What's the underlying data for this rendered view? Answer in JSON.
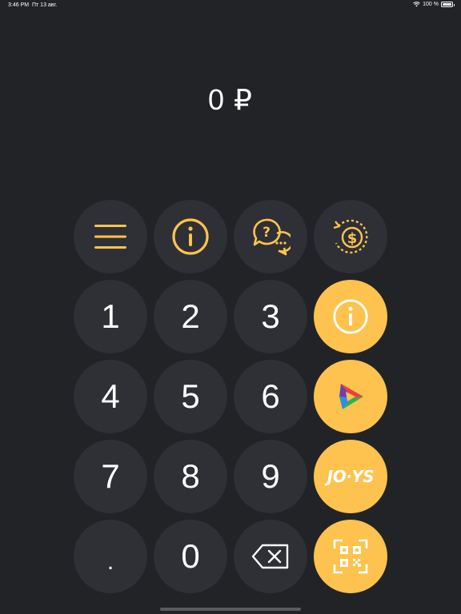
{
  "status_bar": {
    "time": "3:46 PM",
    "date": "Пт 13 авг.",
    "battery": "100 %"
  },
  "display": {
    "amount": "0 ₽"
  },
  "keypad": {
    "keys": {
      "one": "1",
      "two": "2",
      "three": "3",
      "four": "4",
      "five": "5",
      "six": "6",
      "seven": "7",
      "eight": "8",
      "nine": "9",
      "dot": ".",
      "zero": "0"
    },
    "joys_label": "JO·YS"
  },
  "icons": {
    "menu": "menu-icon",
    "info": "info-icon",
    "support": "chat-question-icon",
    "refund": "money-refund-icon",
    "info_action": "info-icon",
    "play": "play-logo-icon",
    "qr": "qr-code-icon",
    "backspace": "backspace-icon"
  },
  "colors": {
    "background": "#222326",
    "key": "#2e3036",
    "accent": "#fec34e"
  }
}
